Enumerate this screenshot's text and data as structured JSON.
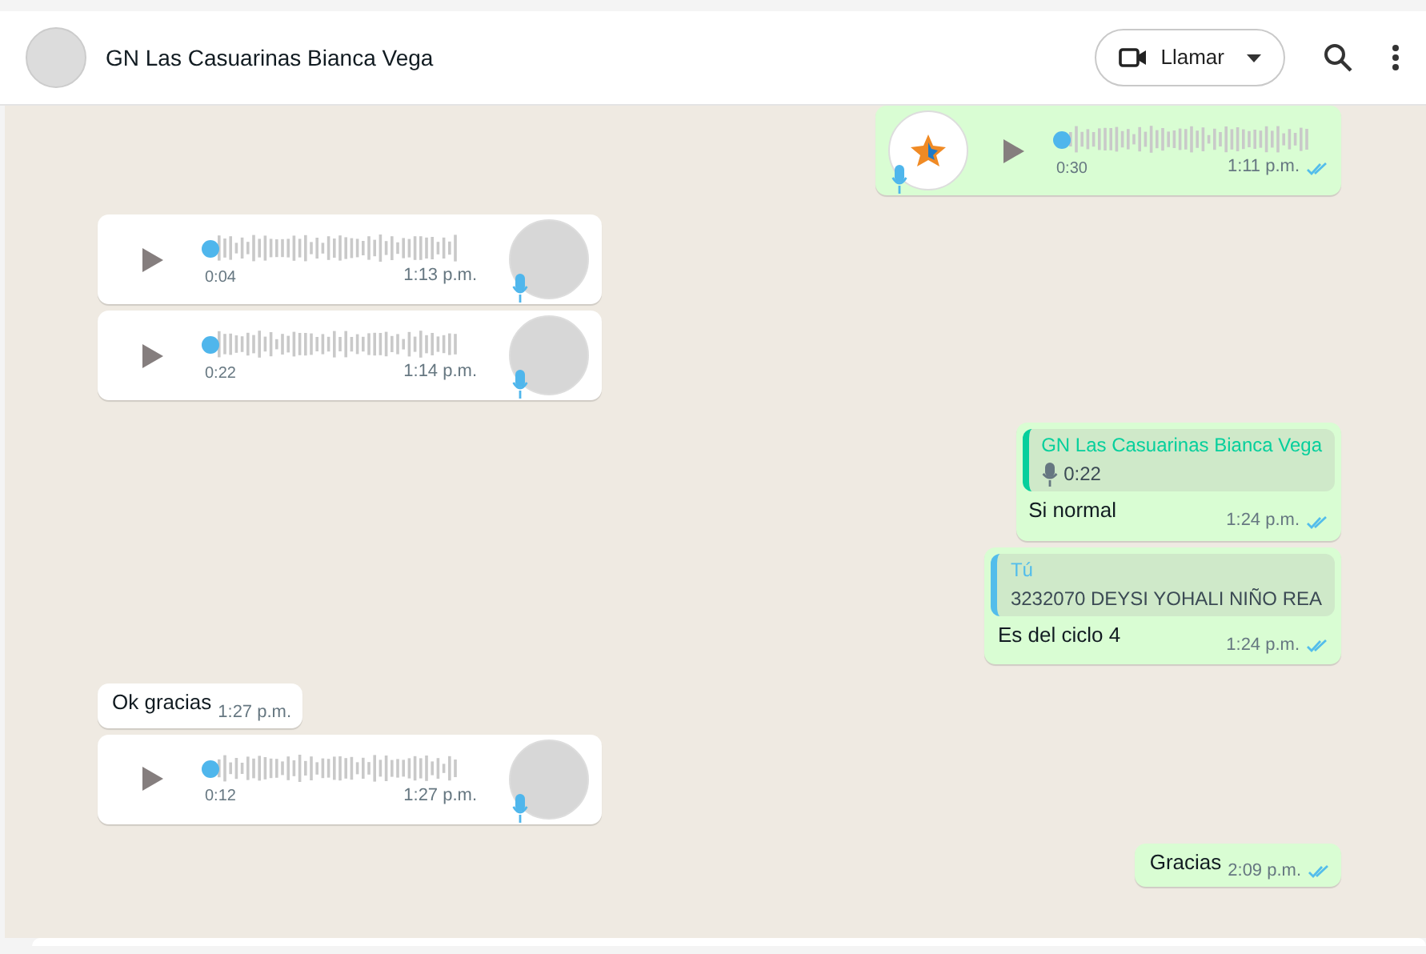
{
  "header": {
    "title": "GN Las Casuarinas Bianca Vega",
    "call_button": "Llamar"
  },
  "messages": [
    {
      "kind": "voice",
      "outgoing": true,
      "duration": "0:30",
      "time": "1:11 p.m.",
      "read": true
    },
    {
      "kind": "voice",
      "outgoing": false,
      "duration": "0:04",
      "time": "1:13 p.m."
    },
    {
      "kind": "voice",
      "outgoing": false,
      "duration": "0:22",
      "time": "1:14 p.m."
    },
    {
      "kind": "reply",
      "outgoing": true,
      "quote": {
        "sender": "GN Las Casuarinas Bianca Vega",
        "color": "#06cf9c",
        "kind": "voice",
        "text": "0:22"
      },
      "text": "Si normal",
      "time": "1:24 p.m.",
      "read": true
    },
    {
      "kind": "reply",
      "outgoing": true,
      "quote": {
        "sender": "Tú",
        "color": "#53bdeb",
        "kind": "text",
        "text": "3232070 DEYSI YOHALI NIÑO REA"
      },
      "text": "Es del ciclo 4",
      "time": "1:24 p.m.",
      "read": true
    },
    {
      "kind": "text",
      "outgoing": false,
      "text": "Ok gracias",
      "time": "1:27 p.m."
    },
    {
      "kind": "voice",
      "outgoing": false,
      "duration": "0:12",
      "time": "1:27 p.m."
    },
    {
      "kind": "text",
      "outgoing": true,
      "text": "Gracias",
      "time": "2:09 p.m.",
      "read": true
    }
  ]
}
